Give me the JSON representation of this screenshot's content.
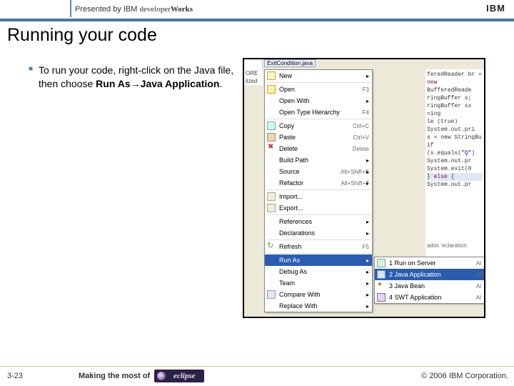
{
  "header": {
    "prefix": "Presented by IBM ",
    "dw1": "developer",
    "dw2": "Works",
    "logo": "IBM"
  },
  "slide": {
    "title": "Running your code",
    "bullet_parts": {
      "p1": "To run your code, right-click on the Java file, then choose ",
      "b1": "Run As",
      "arrow": "→",
      "b2": "Java Application",
      "tail": "."
    }
  },
  "screenshot": {
    "tab": "ExitCondition.java",
    "left_items": [
      "ORE",
      "lized"
    ],
    "code_lines": [
      "feredReader br =",
      "new BufferedReade",
      "ringBuffer s;",
      "ringBuffer sx =ing",
      "le (true)",
      "",
      "System.out.pri",
      "s = new StringBu",
      "if (s.equals(\"Q\")",
      "  System.out.pr",
      "  System.exit(0",
      "} else {",
      "  System.out.pr"
    ],
    "menu": [
      {
        "label": "New",
        "sc": "",
        "ic": "ic-new",
        "arrow": true
      },
      {
        "sep": true
      },
      {
        "label": "Open",
        "sc": "F3",
        "ic": "ic-open"
      },
      {
        "label": "Open With",
        "sc": "",
        "ic": "",
        "arrow": true
      },
      {
        "label": "Open Type Hierarchy",
        "sc": "F4"
      },
      {
        "sep": true
      },
      {
        "label": "Copy",
        "sc": "Ctrl+C",
        "ic": "ic-copy"
      },
      {
        "label": "Paste",
        "sc": "Ctrl+V",
        "ic": "ic-paste"
      },
      {
        "label": "Delete",
        "sc": "Delete",
        "ic": "ic-del"
      },
      {
        "label": "Build Path",
        "arrow": true
      },
      {
        "label": "Source",
        "sc": "Alt+Shift+S",
        "arrow": true
      },
      {
        "label": "Refactor",
        "sc": "Alt+Shift+T",
        "arrow": true
      },
      {
        "sep": true
      },
      {
        "label": "Import...",
        "ic": "ic-imp"
      },
      {
        "label": "Export...",
        "ic": "ic-exp"
      },
      {
        "sep": true
      },
      {
        "label": "References",
        "arrow": true
      },
      {
        "label": "Declarations",
        "arrow": true
      },
      {
        "sep": true
      },
      {
        "label": "Refresh",
        "sc": "F5",
        "ic": "ic-ref"
      },
      {
        "sep": true
      },
      {
        "label": "Run As",
        "arrow": true,
        "sel": true
      },
      {
        "label": "Debug As",
        "arrow": true
      },
      {
        "label": "Team",
        "arrow": true
      },
      {
        "label": "Compare With",
        "ic": "ic-cmp",
        "arrow": true
      },
      {
        "label": "Replace With",
        "arrow": true
      }
    ],
    "submenu": [
      {
        "n": "1",
        "label": "Run on Server",
        "sc": "Al",
        "ic": "ic-srv"
      },
      {
        "n": "2",
        "label": "Java Application",
        "sc": "Al",
        "ic": "ic-japp",
        "sel": true
      },
      {
        "n": "3",
        "label": "Java Bean",
        "sc": "Al",
        "ic": "ic-bean"
      },
      {
        "n": "4",
        "label": "SWT Application",
        "sc": "Al",
        "ic": "ic-swt"
      }
    ],
    "bottom_tabs": "adoc  'eclaration"
  },
  "footer": {
    "page": "3-23",
    "mid": "Making the most of",
    "eclipse": "eclipse",
    "right": "© 2006 IBM Corporation."
  }
}
